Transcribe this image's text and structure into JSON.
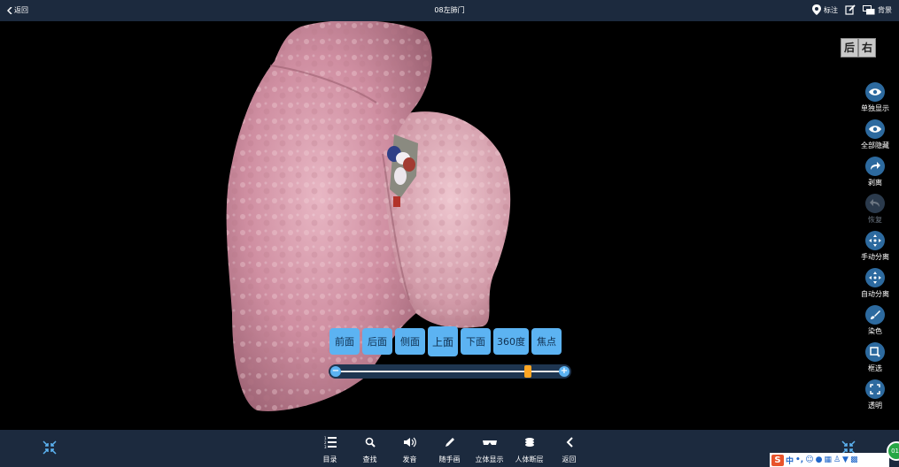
{
  "header": {
    "back_label": "返回",
    "title": "08左肺门",
    "annotate_label": "标注",
    "background_label": "背景"
  },
  "viewport": {
    "orientation_badge": [
      "后",
      "右"
    ]
  },
  "side_tools": [
    {
      "label": "单独显示",
      "icon": "eye-icon",
      "enabled": true
    },
    {
      "label": "全部隐藏",
      "icon": "eye-icon",
      "enabled": true
    },
    {
      "label": "剥离",
      "icon": "redo-arrow-icon",
      "enabled": true
    },
    {
      "label": "恢复",
      "icon": "undo-arrow-icon",
      "enabled": false
    },
    {
      "label": "手动分离",
      "icon": "move-arrows-icon",
      "enabled": true
    },
    {
      "label": "自动分离",
      "icon": "move-arrows-icon",
      "enabled": true
    },
    {
      "label": "染色",
      "icon": "brush-icon",
      "enabled": true
    },
    {
      "label": "框选",
      "icon": "box-select-icon",
      "enabled": true
    },
    {
      "label": "透明",
      "icon": "transparency-icon",
      "enabled": true
    }
  ],
  "view_buttons": {
    "items": [
      "前面",
      "后面",
      "侧面",
      "上面",
      "下面",
      "360度",
      "焦点"
    ],
    "active": "上面"
  },
  "zoom": {
    "level": 0.87,
    "minus": "−",
    "plus": "+"
  },
  "bottom_nav": [
    {
      "label": "目录",
      "icon": "list-icon"
    },
    {
      "label": "查找",
      "icon": "search-icon"
    },
    {
      "label": "发音",
      "icon": "speaker-icon"
    },
    {
      "label": "随手画",
      "icon": "pen-icon"
    },
    {
      "label": "立体显示",
      "icon": "3d-glasses-icon"
    },
    {
      "label": "人体断层",
      "icon": "layers-icon"
    },
    {
      "label": "返回",
      "icon": "chevron-left-icon"
    }
  ],
  "ime": {
    "logo": "S",
    "mode": "中",
    "punct": "•,"
  },
  "badge_text": "01",
  "colors": {
    "bar": "#1c2a3e",
    "button": "#5cb3f2",
    "tool_circle": "#2d6a9f",
    "slider_knob": "#ffa623"
  }
}
